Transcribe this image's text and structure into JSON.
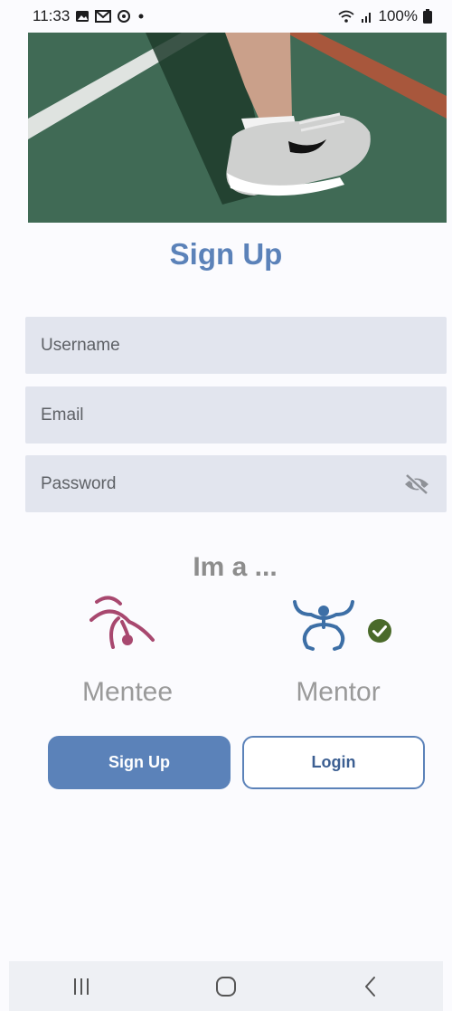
{
  "status_bar": {
    "time": "11:33",
    "battery": "100%",
    "left_icons": [
      "gallery-icon",
      "gmail-icon",
      "sync-icon",
      "dot-icon"
    ],
    "right_icons": [
      "wifi-icon",
      "signal-icon",
      "battery-icon"
    ]
  },
  "hero": {
    "subject": "sneaker-on-tennis-court"
  },
  "page": {
    "title": "Sign Up"
  },
  "form": {
    "username_placeholder": "Username",
    "email_placeholder": "Email",
    "password_placeholder": "Password",
    "password_toggle_icon": "eye-off-icon"
  },
  "roles": {
    "heading": "Im a ...",
    "mentee_label": "Mentee",
    "mentor_label": "Mentor",
    "selected": "Mentor",
    "mentee_color": "#a8486f",
    "mentor_color": "#3d6fa6",
    "check_color": "#4a6a2a"
  },
  "buttons": {
    "signup_label": "Sign Up",
    "login_label": "Login"
  },
  "colors": {
    "accent": "#5b82b9",
    "field_bg": "#e2e5ee",
    "background": "#fbfbfe"
  },
  "nav_bar": {
    "icons": [
      "recents-icon",
      "home-icon",
      "back-icon"
    ]
  }
}
